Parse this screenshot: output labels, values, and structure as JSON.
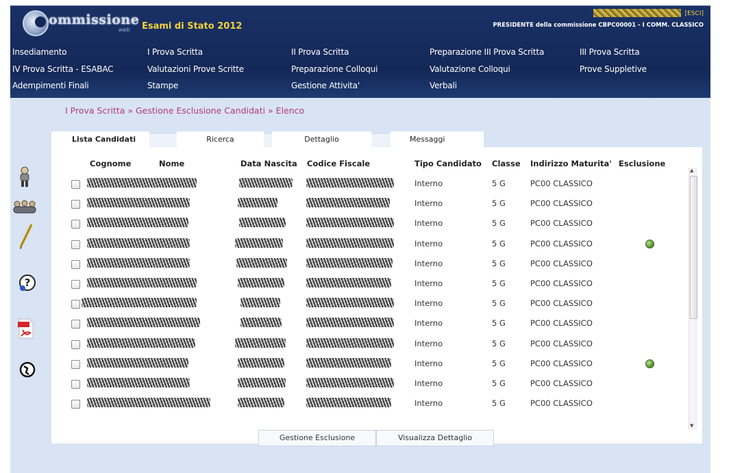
{
  "header": {
    "logo_text": "ommissione",
    "logo_sub": "web",
    "exam_title": "Esami di Stato 2012",
    "logout_label": "[ESCI]",
    "role_line": "PRESIDENTE della commissione CBPC00001 - I COMM. CLASSICO"
  },
  "menu": [
    "Insediamento",
    "I Prova Scritta",
    "II Prova Scritta",
    "Preparazione III Prova Scritta",
    "III Prova Scritta",
    "IV Prova Scritta - ESABAC",
    "Valutazioni Prove Scritte",
    "Preparazione Colloqui",
    "Valutazione Colloqui",
    "Prove Suppletive",
    "Adempimenti Finali",
    "Stampe",
    "Gestione Attivita'",
    "Verbali"
  ],
  "breadcrumb": "I Prova Scritta » Gestione Esclusione Candidati » Elenco",
  "tabs": [
    "Lista Candidati",
    "Ricerca",
    "Dettaglio",
    "Messaggi"
  ],
  "columns": [
    "Cognome",
    "Nome",
    "Data Nascita",
    "Codice Fiscale",
    "Tipo Candidato",
    "Classe",
    "Indirizzo Maturita'",
    "Esclusione"
  ],
  "rows": [
    {
      "tipo": "Interno",
      "classe": "5 G",
      "indirizzo": "PC00 CLASSICO",
      "esclusione": false
    },
    {
      "tipo": "Interno",
      "classe": "5 G",
      "indirizzo": "PC00 CLASSICO",
      "esclusione": false
    },
    {
      "tipo": "Interno",
      "classe": "5 G",
      "indirizzo": "PC00 CLASSICO",
      "esclusione": false
    },
    {
      "tipo": "Interno",
      "classe": "5 G",
      "indirizzo": "PC00 CLASSICO",
      "esclusione": true
    },
    {
      "tipo": "Interno",
      "classe": "5 G",
      "indirizzo": "PC00 CLASSICO",
      "esclusione": false
    },
    {
      "tipo": "Interno",
      "classe": "5 G",
      "indirizzo": "PC00 CLASSICO",
      "esclusione": false
    },
    {
      "tipo": "Interno",
      "classe": "5 G",
      "indirizzo": "PC00 CLASSICO",
      "esclusione": false
    },
    {
      "tipo": "Interno",
      "classe": "5 G",
      "indirizzo": "PC00 CLASSICO",
      "esclusione": false
    },
    {
      "tipo": "Interno",
      "classe": "5 G",
      "indirizzo": "PC00 CLASSICO",
      "esclusione": false
    },
    {
      "tipo": "Interno",
      "classe": "5 G",
      "indirizzo": "PC00 CLASSICO",
      "esclusione": true
    },
    {
      "tipo": "Interno",
      "classe": "5 G",
      "indirizzo": "PC00 CLASSICO",
      "esclusione": false
    },
    {
      "tipo": "Interno",
      "classe": "5 G",
      "indirizzo": "PC00 CLASSICO",
      "esclusione": false
    }
  ],
  "buttons": {
    "exclusion": "Gestione Esclusione",
    "detail": "Visualizza Dettaglio"
  },
  "side_icons": [
    "user-icon",
    "group-icon",
    "pen-icon",
    "help-icon",
    "pdf-icon",
    "globe-icon"
  ],
  "colors": {
    "header_bg": "#142857",
    "title_yellow": "#f3d23a",
    "breadcrumb": "#b1387e",
    "page_bg": "#d8e4f3"
  }
}
